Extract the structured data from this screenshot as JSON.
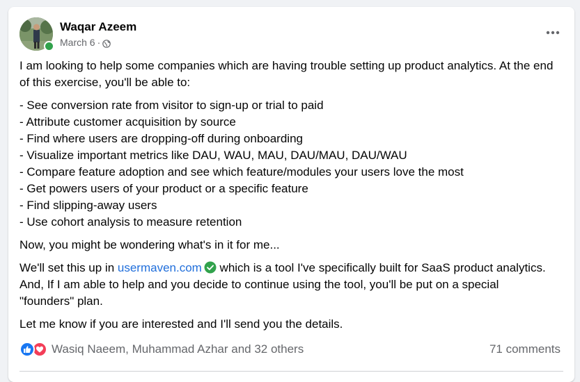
{
  "post": {
    "author": "Waqar Azeem",
    "date": "March 6",
    "meta_separator": "·",
    "audience_icon": "globe-icon",
    "more_icon": "more-horizontal-icon",
    "intro": "I am looking to help some companies which are having trouble setting up product analytics. At the end of this exercise, you'll be able to:",
    "list": [
      "- See conversion rate from visitor to sign-up or trial to paid",
      "- Attribute customer acquisition by source",
      "- Find where users are dropping-off during onboarding",
      "- Visualize important metrics like DAU, WAU, MAU, DAU/MAU, DAU/WAU",
      "- Compare feature adoption and see which feature/modules your users love the most",
      "- Get powers users of your product or a specific feature",
      "- Find slipping-away users",
      "- Use cohort analysis to measure retention"
    ],
    "wondering": "Now, you might be wondering what's in it for me...",
    "setup_prefix": "We'll set this up in ",
    "setup_link": "usermaven.com",
    "setup_suffix": " which is a tool I've specifically built for SaaS product analytics. And, If I am able to help and you decide to continue using the tool, you'll be put on a special \"founders\" plan.",
    "closing": "Let me know if you are interested and I'll send you the details."
  },
  "reactions": {
    "icons": [
      "like-icon",
      "love-icon"
    ],
    "summary": "Wasiq Naeem, Muhammad Azhar and 32 others",
    "comments": "71 comments"
  },
  "colors": {
    "link": "#216fdb",
    "like": "#1877f2",
    "love": "#f33e58",
    "online": "#31a24c",
    "verified": "#31a24c",
    "secondary_text": "#65676b"
  }
}
